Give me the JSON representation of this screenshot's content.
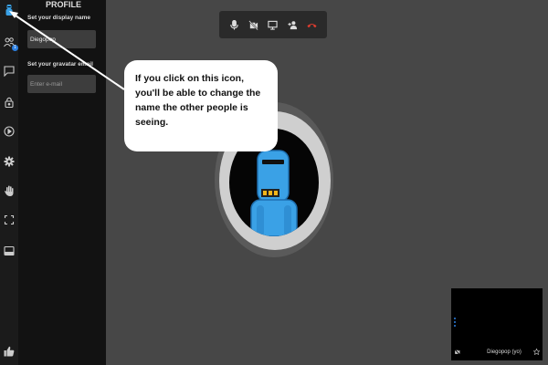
{
  "profile_panel": {
    "title": "PROFILE",
    "display_name_label": "Set your display name",
    "display_name_value": "Diegopop",
    "gravatar_label": "Set your gravatar email",
    "gravatar_placeholder": "Enter e-mail"
  },
  "left_toolbar": {
    "items": [
      {
        "icon": "avatar-icon"
      },
      {
        "icon": "participants-icon",
        "badge": "1"
      },
      {
        "icon": "chat-icon"
      },
      {
        "icon": "lock-icon"
      },
      {
        "icon": "play-icon"
      },
      {
        "icon": "settings-gear-icon"
      },
      {
        "icon": "raise-hand-icon"
      },
      {
        "icon": "fullscreen-icon"
      },
      {
        "icon": "filmstrip-icon"
      },
      {
        "icon": "thumbs-up-icon"
      }
    ]
  },
  "call_toolbar": {
    "buttons": [
      "microphone-icon",
      "camera-off-icon",
      "screen-share-icon",
      "invite-icon",
      "hangup-icon"
    ],
    "hangup_color": "#e03c2f"
  },
  "tooltip": {
    "text": "If you click on this icon, you'll be able to change the name the other people is seeing."
  },
  "self_view": {
    "name": "Diegopop (yo)"
  },
  "colors": {
    "background": "#474747",
    "sidebar": "#1b1b1b",
    "panel": "#121212",
    "accent": "#2c7fe0",
    "robot_blue": "#3aa1e6"
  }
}
